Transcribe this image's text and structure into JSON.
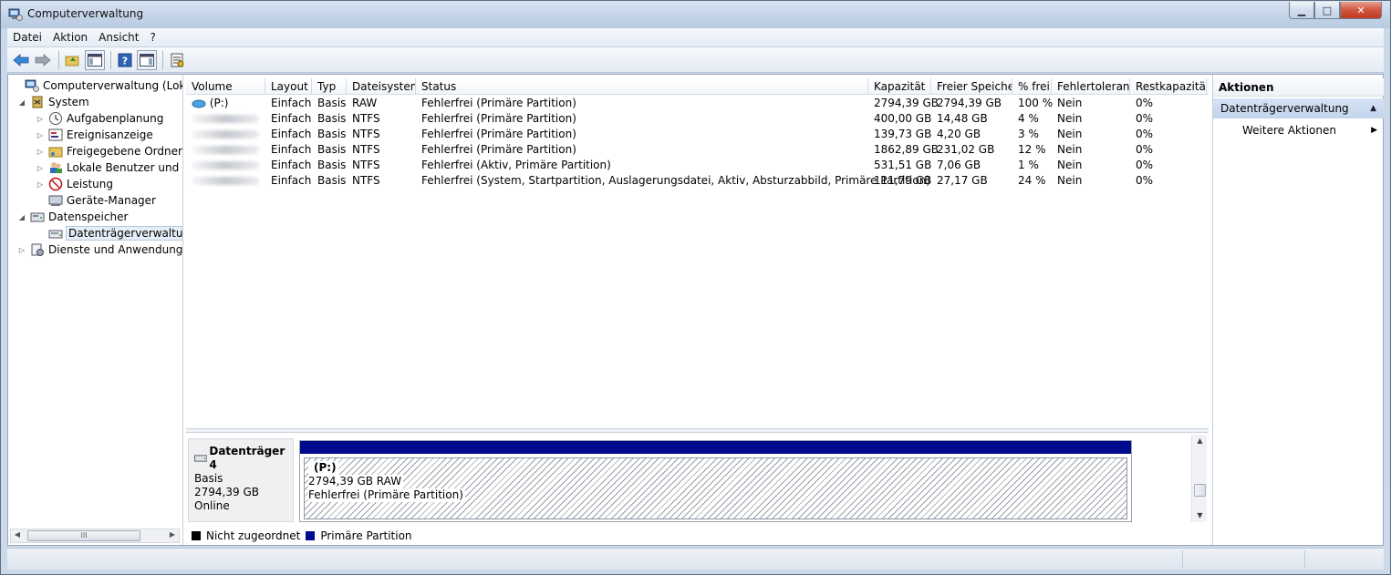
{
  "window": {
    "title": "Computerverwaltung"
  },
  "menu": [
    "Datei",
    "Aktion",
    "Ansicht",
    "?"
  ],
  "tree": {
    "items": [
      {
        "label": "Computerverwaltung (Lokal)",
        "name": "tree-root",
        "icon": "computer-management-icon"
      },
      {
        "label": "System",
        "name": "tree-system",
        "icon": "system-tools-icon"
      },
      {
        "label": "Aufgabenplanung",
        "name": "tree-aufgabenplanung",
        "icon": "clock-icon"
      },
      {
        "label": "Ereignisanzeige",
        "name": "tree-ereignisanzeige",
        "icon": "event-viewer-icon"
      },
      {
        "label": "Freigegebene Ordner",
        "name": "tree-freigegebene-ordner",
        "icon": "shared-folder-icon"
      },
      {
        "label": "Lokale Benutzer und Gr",
        "name": "tree-lokale-benutzer",
        "icon": "users-icon"
      },
      {
        "label": "Leistung",
        "name": "tree-leistung",
        "icon": "performance-icon"
      },
      {
        "label": "Geräte-Manager",
        "name": "tree-geraete-manager",
        "icon": "device-manager-icon"
      },
      {
        "label": "Datenspeicher",
        "name": "tree-datenspeicher",
        "icon": "storage-icon"
      },
      {
        "label": "Datenträgerverwaltung",
        "name": "tree-datentraegerverwaltung",
        "icon": "disk-management-icon"
      },
      {
        "label": "Dienste und Anwendungen",
        "name": "tree-dienste",
        "icon": "services-icon"
      }
    ],
    "scroll_grip": "III"
  },
  "table": {
    "columns": [
      "Volume",
      "Layout",
      "Typ",
      "Dateisystem",
      "Status",
      "Kapazität",
      "Freier Speicher",
      "% frei",
      "Fehlertoleranz",
      "Restkapazität"
    ],
    "rows": [
      {
        "volume": "(P:)",
        "layout": "Einfach",
        "typ": "Basis",
        "fs": "RAW",
        "status": "Fehlerfrei (Primäre Partition)",
        "kap": "2794,39 GB",
        "frei": "2794,39 GB",
        "pct": "100 %",
        "fehler": "Nein",
        "rest": "0%"
      },
      {
        "volume": "",
        "layout": "Einfach",
        "typ": "Basis",
        "fs": "NTFS",
        "status": "Fehlerfrei (Primäre Partition)",
        "kap": "400,00 GB",
        "frei": "14,48 GB",
        "pct": "4 %",
        "fehler": "Nein",
        "rest": "0%"
      },
      {
        "volume": "",
        "layout": "Einfach",
        "typ": "Basis",
        "fs": "NTFS",
        "status": "Fehlerfrei (Primäre Partition)",
        "kap": "139,73 GB",
        "frei": "4,20 GB",
        "pct": "3 %",
        "fehler": "Nein",
        "rest": "0%"
      },
      {
        "volume": "",
        "layout": "Einfach",
        "typ": "Basis",
        "fs": "NTFS",
        "status": "Fehlerfrei (Primäre Partition)",
        "kap": "1862,89 GB",
        "frei": "231,02 GB",
        "pct": "12 %",
        "fehler": "Nein",
        "rest": "0%"
      },
      {
        "volume": "",
        "layout": "Einfach",
        "typ": "Basis",
        "fs": "NTFS",
        "status": "Fehlerfrei (Aktiv, Primäre Partition)",
        "kap": "531,51 GB",
        "frei": "7,06 GB",
        "pct": "1 %",
        "fehler": "Nein",
        "rest": "0%"
      },
      {
        "volume": "",
        "layout": "Einfach",
        "typ": "Basis",
        "fs": "NTFS",
        "status": "Fehlerfrei (System, Startpartition, Auslagerungsdatei, Aktiv, Absturzabbild, Primäre Partition)",
        "kap": "111,79 GB",
        "frei": "27,17 GB",
        "pct": "24 %",
        "fehler": "Nein",
        "rest": "0%"
      }
    ]
  },
  "disk": {
    "name": "Datenträger 4",
    "type": "Basis",
    "size": "2794,39 GB",
    "state": "Online",
    "partition": {
      "label": "(P:)",
      "size_fs": "2794,39 GB RAW",
      "status": "Fehlerfrei (Primäre Partition)"
    }
  },
  "legend": {
    "unallocated": "Nicht zugeordnet",
    "primary": "Primäre Partition",
    "unallocated_color": "#000000",
    "primary_color": "#000a8c"
  },
  "actions": {
    "title": "Aktionen",
    "section": "Datenträgerverwaltung",
    "more": "Weitere Aktionen"
  }
}
